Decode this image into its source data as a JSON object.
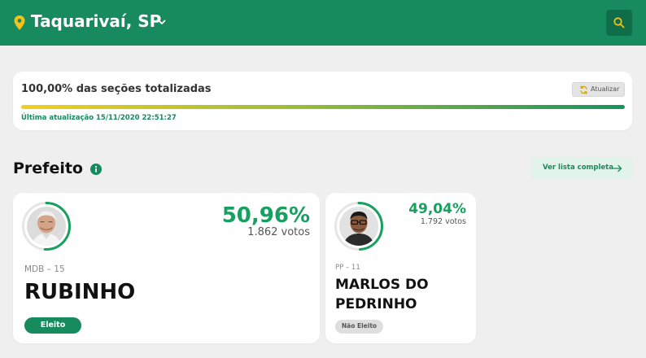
{
  "header": {
    "location": "Taquarivaí, SP",
    "location_icon": "map-pin-icon",
    "chevron_icon": "chevron-down-icon",
    "search_icon": "search-icon",
    "bg_color": "#178a5e"
  },
  "status": {
    "title": "100,00% das seções totalizadas",
    "progress": 1.0,
    "refresh_label": "Atualizar",
    "last_update": "Última atualização 15/11/2020 22:51:27"
  },
  "section": {
    "title": "Prefeito",
    "info_icon": "info-icon",
    "full_list_label": "Ver lista completa",
    "arrow_icon": "arrow-right-icon"
  },
  "candidates": [
    {
      "percent": "50,96%",
      "percent_value": 0.5096,
      "votes": "1.862 votos",
      "party": "MDB – 15",
      "name": "RUBINHO",
      "status": "Eleito"
    },
    {
      "percent": "49,04%",
      "percent_value": 0.4904,
      "votes": "1.792 votos",
      "party": "PP – 11",
      "name": "MARLOS DO PEDRINHO",
      "status": "Não Eleito"
    }
  ],
  "colors": {
    "accent_green": "#178a5e",
    "percent_green": "#17a05f",
    "progress_start": "#f2cf1d",
    "progress_end": "#17935f"
  }
}
